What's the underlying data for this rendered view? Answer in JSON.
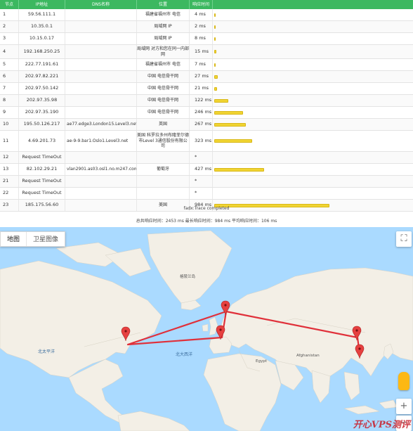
{
  "table": {
    "headers": [
      "节点",
      "IP地址",
      "DNS名称",
      "位置",
      "响应时间"
    ],
    "rows": [
      {
        "hop": "1",
        "ip": "59.56.111.1",
        "dns": "",
        "loc": "福建省福州市 电信",
        "time": "4 ms",
        "ms": 4
      },
      {
        "hop": "2",
        "ip": "10.35.0.1",
        "dns": "",
        "loc": "局域网 IP",
        "time": "2 ms",
        "ms": 2
      },
      {
        "hop": "3",
        "ip": "10.15.0.17",
        "dns": "",
        "loc": "局域网 IP",
        "time": "8 ms",
        "ms": 8
      },
      {
        "hop": "4",
        "ip": "192.168.250.25",
        "dns": "",
        "loc": "局域网 对方和您在同一内部网",
        "time": "15 ms",
        "ms": 15
      },
      {
        "hop": "5",
        "ip": "222.77.191.61",
        "dns": "",
        "loc": "福建省福州市 电信",
        "time": "7 ms",
        "ms": 7
      },
      {
        "hop": "6",
        "ip": "202.97.82.221",
        "dns": "",
        "loc": "中国 电信骨干网",
        "time": "27 ms",
        "ms": 27
      },
      {
        "hop": "7",
        "ip": "202.97.50.142",
        "dns": "",
        "loc": "中国 电信骨干网",
        "time": "21 ms",
        "ms": 21
      },
      {
        "hop": "8",
        "ip": "202.97.35.98",
        "dns": "",
        "loc": "中国 电信骨干网",
        "time": "122 ms",
        "ms": 122
      },
      {
        "hop": "9",
        "ip": "202.97.35.190",
        "dns": "",
        "loc": "中国 电信骨干网",
        "time": "246 ms",
        "ms": 246
      },
      {
        "hop": "10",
        "ip": "195.50.126.217",
        "dns": "ae77.edge3.London15.Level3.net",
        "loc": "英国",
        "time": "267 ms",
        "ms": 267
      },
      {
        "hop": "11",
        "ip": "4.69.201.73",
        "dns": "ae-9-9.bar1.Oslo1.Level3.net",
        "loc": "美国 科罗拉多州布隆菲尔德市Level 3通信股份有限公司",
        "time": "323 ms",
        "ms": 323
      },
      {
        "hop": "12",
        "ip": "Request TimeOut",
        "dns": "",
        "loc": "",
        "time": "*",
        "ms": null
      },
      {
        "hop": "13",
        "ip": "82.102.29.21",
        "dns": "vlan2901.as03.osl1.no.m247.com",
        "loc": "葡萄牙",
        "time": "427 ms",
        "ms": 427
      },
      {
        "hop": "21",
        "ip": "Request TimeOut",
        "dns": "",
        "loc": "",
        "time": "*",
        "ms": null
      },
      {
        "hop": "22",
        "ip": "Request TimeOut",
        "dns": "",
        "loc": "",
        "time": "*",
        "ms": null
      },
      {
        "hop": "23",
        "ip": "185.175.56.60",
        "dns": "",
        "loc": "美国",
        "time": "984 ms",
        "ms": 984
      }
    ],
    "complete": "fadx:Trace completed",
    "totals": "总共响应时间：2453 ms     最长响应时间：984 ms     平均响应时间：106 ms"
  },
  "map": {
    "tab_map": "地图",
    "tab_satellite": "卫星图像",
    "fullscreen": "⛶",
    "zoom_in": "+",
    "zoom_out": "−",
    "watermark": "开心VPS测评",
    "labels": {
      "greenland": "格陵兰岛",
      "north_atlantic": "北大西洋",
      "north_pacific": "北太平洋",
      "egypt": "Egypt",
      "afghanistan": "Afghanistan"
    },
    "colors": {
      "water": "#aadaff",
      "land": "#f3efe6",
      "route": "#e0303a",
      "pin": "#e64040"
    }
  }
}
